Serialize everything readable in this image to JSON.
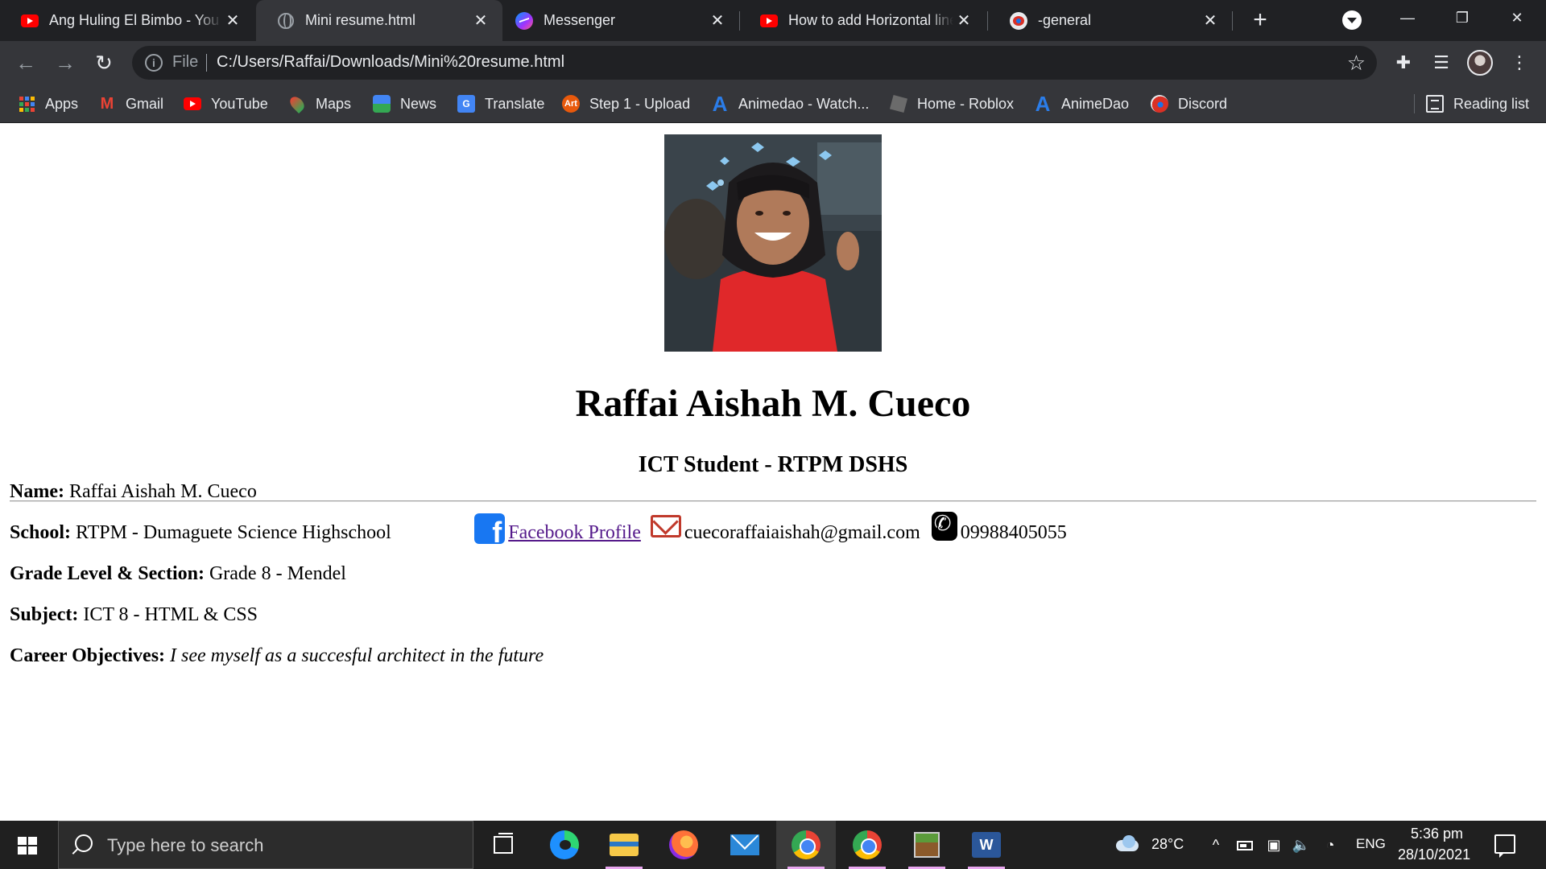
{
  "browser": {
    "tabs": [
      {
        "title": "Ang Huling El Bimbo - You",
        "icon": "youtube-icon",
        "active": false
      },
      {
        "title": "Mini resume.html",
        "icon": "globe-icon",
        "active": true
      },
      {
        "title": "Messenger",
        "icon": "messenger-icon",
        "active": false
      },
      {
        "title": "How to add Horizontal line",
        "icon": "youtube-icon",
        "active": false
      },
      {
        "title": "-general",
        "icon": "discord-icon",
        "active": false
      }
    ],
    "address_scheme": "File",
    "url": "C:/Users/Raffai/Downloads/Mini%20resume.html",
    "bookmarks": [
      {
        "label": "Apps",
        "icon": "apps-grid-icon"
      },
      {
        "label": "Gmail",
        "icon": "gmail-icon"
      },
      {
        "label": "YouTube",
        "icon": "youtube-icon"
      },
      {
        "label": "Maps",
        "icon": "maps-icon"
      },
      {
        "label": "News",
        "icon": "news-icon"
      },
      {
        "label": "Translate",
        "icon": "translate-icon"
      },
      {
        "label": "Step 1 - Upload",
        "icon": "art-icon"
      },
      {
        "label": "Animedao - Watch...",
        "icon": "animedao-icon"
      },
      {
        "label": "Home - Roblox",
        "icon": "roblox-icon"
      },
      {
        "label": "AnimeDao",
        "icon": "animedao-icon"
      },
      {
        "label": "Discord",
        "icon": "discord-icon"
      }
    ],
    "reading_list": "Reading list"
  },
  "resume": {
    "name": "Raffai Aishah M. Cueco",
    "subtitle": "ICT Student - RTPM DSHS",
    "contact": {
      "facebook_link": "Facebook Profile",
      "email": "cuecoraffaiaishah@gmail.com",
      "phone": "09988405055"
    },
    "fields": [
      {
        "label": "Name:",
        "value": "Raffai Aishah M. Cueco"
      },
      {
        "label": "School:",
        "value": "RTPM - Dumaguete Science Highschool"
      },
      {
        "label": "Grade Level & Section:",
        "value": "Grade 8 - Mendel"
      },
      {
        "label": "Subject:",
        "value": "ICT 8 - HTML & CSS"
      },
      {
        "label": "Career Objectives:",
        "value": "I see myself as a succesful architect in the future"
      }
    ]
  },
  "taskbar": {
    "search_placeholder": "Type here to search",
    "temperature": "28°C",
    "language": "ENG",
    "time": "5:36 pm",
    "date": "28/10/2021"
  },
  "colors": {
    "tab_strip": "#202124",
    "toolbar": "#35363a",
    "link": "#551a8b",
    "taskbar": "#202020"
  }
}
